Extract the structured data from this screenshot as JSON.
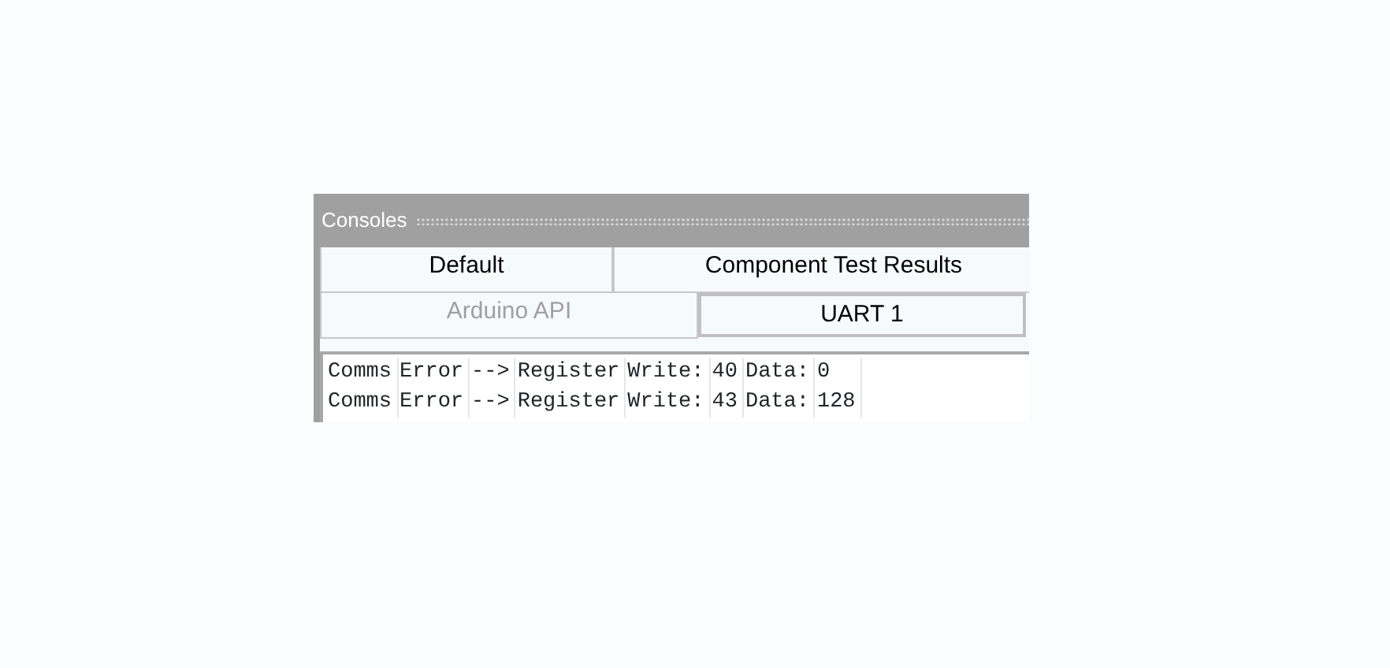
{
  "panel": {
    "title": "Consoles"
  },
  "tab_rows": [
    [
      {
        "label": "Default",
        "selected": false,
        "disabled": false
      },
      {
        "label": "Component Test Results",
        "selected": false,
        "disabled": false
      }
    ],
    [
      {
        "label": "Arduino API",
        "selected": false,
        "disabled": true
      },
      {
        "label": "UART 1",
        "selected": true,
        "disabled": false
      }
    ]
  ],
  "console_lines": [
    [
      "Comms",
      "Error",
      "-->",
      "Register",
      "Write:",
      "40",
      "Data:",
      "0"
    ],
    [
      "Comms",
      "Error",
      "-->",
      "Register",
      "Write:",
      "43",
      "Data:",
      "128"
    ]
  ]
}
